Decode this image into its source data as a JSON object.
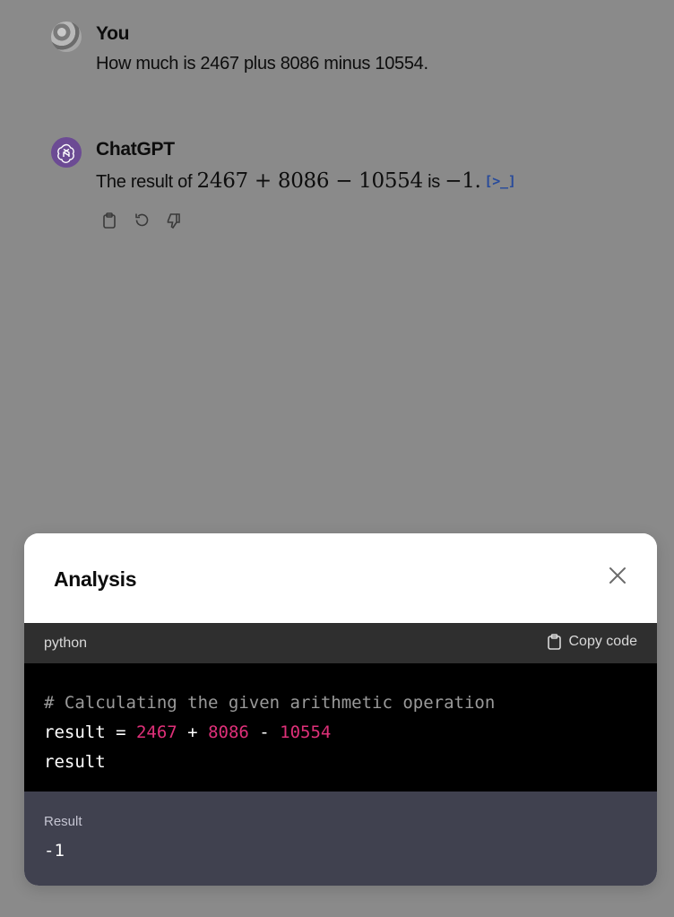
{
  "conversation": {
    "user": {
      "author": "You",
      "text": "How much is 2467 plus 8086 minus 10554."
    },
    "assistant": {
      "author": "ChatGPT",
      "text_prefix": "The result of ",
      "expression": "2467 + 8086 − 10554",
      "text_mid": " is ",
      "result": "−1.",
      "code_link_label": "[>_]",
      "actions": [
        "copy-icon",
        "regenerate-icon",
        "thumbs-down-icon"
      ]
    }
  },
  "modal": {
    "title": "Analysis",
    "code_language": "python",
    "copy_label": "Copy code",
    "code": {
      "line1": "# Calculating the given arithmetic operation",
      "line2_var": "result",
      "line2_eq": " = ",
      "line2_a": "2467",
      "line2_plus": " + ",
      "line2_b": "8086",
      "line2_minus": " - ",
      "line2_c": "10554",
      "line3": "result"
    },
    "result_label": "Result",
    "result_value": "-1"
  },
  "colors": {
    "overlay": "#8a8a8a",
    "code_bg": "#000000",
    "code_header_bg": "#2f2f2f",
    "result_bg": "#40414f",
    "number_token": "#df3079",
    "gpt_avatar": "#6c4b94"
  }
}
